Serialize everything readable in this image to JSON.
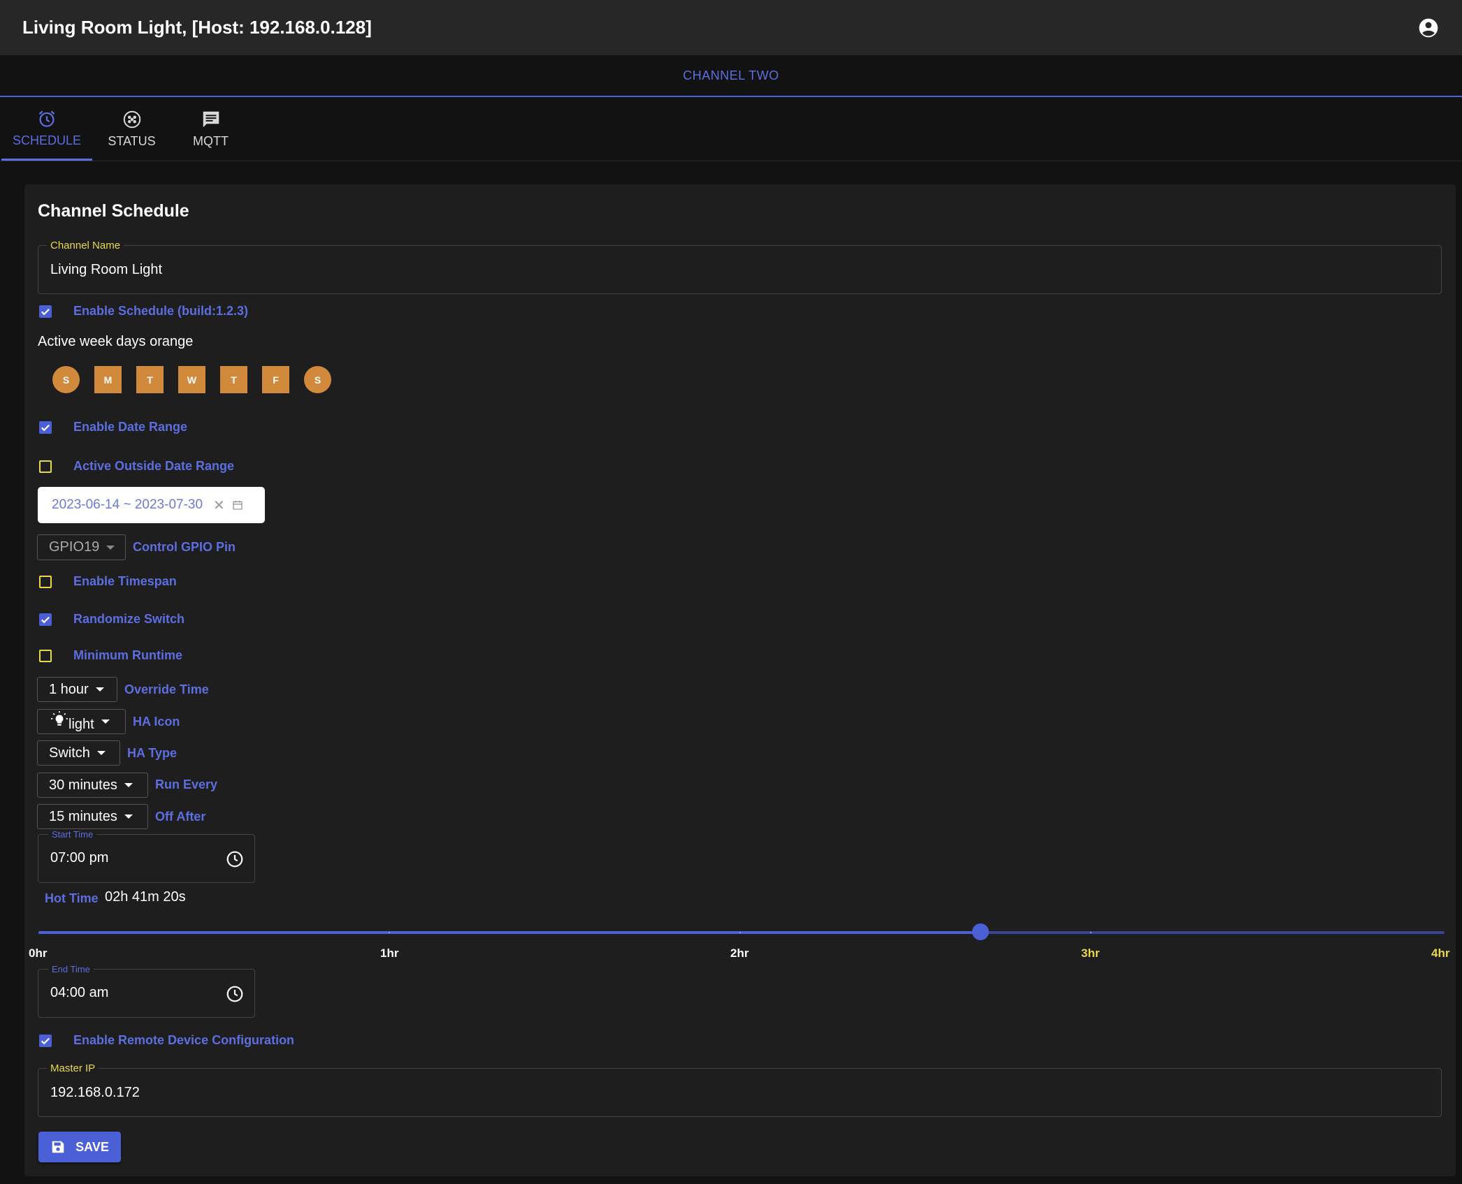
{
  "appbar": {
    "title": "Living Room Light, [Host: 192.168.0.128]",
    "account_icon": "account-circle-icon"
  },
  "channel": {
    "tab_label": "CHANNEL TWO"
  },
  "tabs": [
    {
      "label": "SCHEDULE",
      "icon": "alarm-clock-icon",
      "active": true
    },
    {
      "label": "STATUS",
      "icon": "status-icon",
      "active": false
    },
    {
      "label": "MQTT",
      "icon": "message-icon",
      "active": false
    }
  ],
  "schedule": {
    "title": "Channel Schedule",
    "channel_name": {
      "label": "Channel Name",
      "value": "Living Room Light"
    },
    "enable_schedule": {
      "label": "Enable Schedule (build:1.2.3)",
      "checked": true
    },
    "weekdays_label": "Active week days orange",
    "weekdays": [
      "S",
      "M",
      "T",
      "W",
      "T",
      "F",
      "S"
    ],
    "enable_date_range": {
      "label": "Enable Date Range",
      "checked": true
    },
    "active_outside": {
      "label": "Active Outside Date Range",
      "checked": false
    },
    "date_range": "2023-06-14 ~ 2023-07-30",
    "gpio": {
      "value": "GPIO19",
      "label": "Control GPIO Pin"
    },
    "enable_timespan": {
      "label": "Enable Timespan",
      "checked": false
    },
    "randomize": {
      "label": "Randomize Switch",
      "checked": true
    },
    "min_runtime": {
      "label": "Minimum Runtime",
      "checked": false
    },
    "override": {
      "value": "1 hour",
      "label": "Override Time"
    },
    "ha_icon": {
      "value": "light",
      "label": "HA Icon"
    },
    "ha_type": {
      "value": "Switch",
      "label": "HA Type"
    },
    "run_every": {
      "value": "30 minutes",
      "label": "Run Every"
    },
    "off_after": {
      "value": "15 minutes",
      "label": "Off After"
    },
    "start_time": {
      "label": "Start Time",
      "value": "07:00 pm"
    },
    "hot_time": {
      "label": "Hot Time",
      "value": "02h 41m 20s"
    },
    "slider": {
      "marks": [
        "0hr",
        "1hr",
        "2hr",
        "3hr",
        "4hr"
      ],
      "value_hours": 2.69,
      "max_hours": 4
    },
    "end_time": {
      "label": "End Time",
      "value": "04:00 am"
    },
    "remote_config": {
      "label": "Enable Remote Device Configuration",
      "checked": true
    },
    "master_ip": {
      "label": "Master IP",
      "value": "192.168.0.172"
    },
    "save_label": "SAVE"
  },
  "colors": {
    "accent": "#4b5fd6",
    "day_active": "#d18a3c",
    "legend_yellow": "#e8d84a"
  }
}
